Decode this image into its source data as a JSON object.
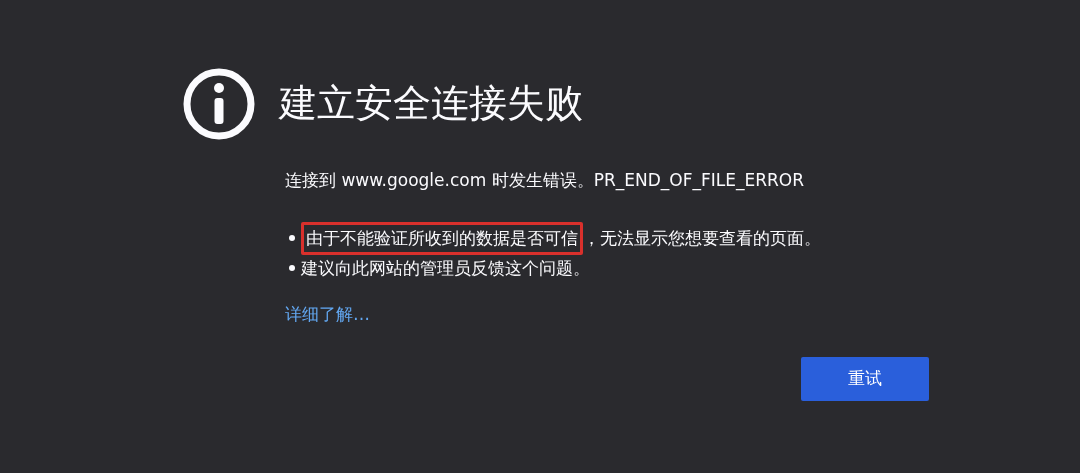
{
  "title": "建立安全连接失败",
  "message": "连接到 www.google.com 时发生错误。PR_END_OF_FILE_ERROR",
  "bullets": [
    {
      "segments": [
        {
          "text": "由于不能验证所收到的数据是否可信",
          "highlighted": true
        },
        {
          "text": "，无法显示您想要查看的页面。",
          "highlighted": false
        }
      ]
    },
    {
      "segments": [
        {
          "text": "建议向此网站的管理员反馈这个问题。",
          "highlighted": false
        }
      ]
    }
  ],
  "learn_more": "详细了解…",
  "retry_button": "重试"
}
